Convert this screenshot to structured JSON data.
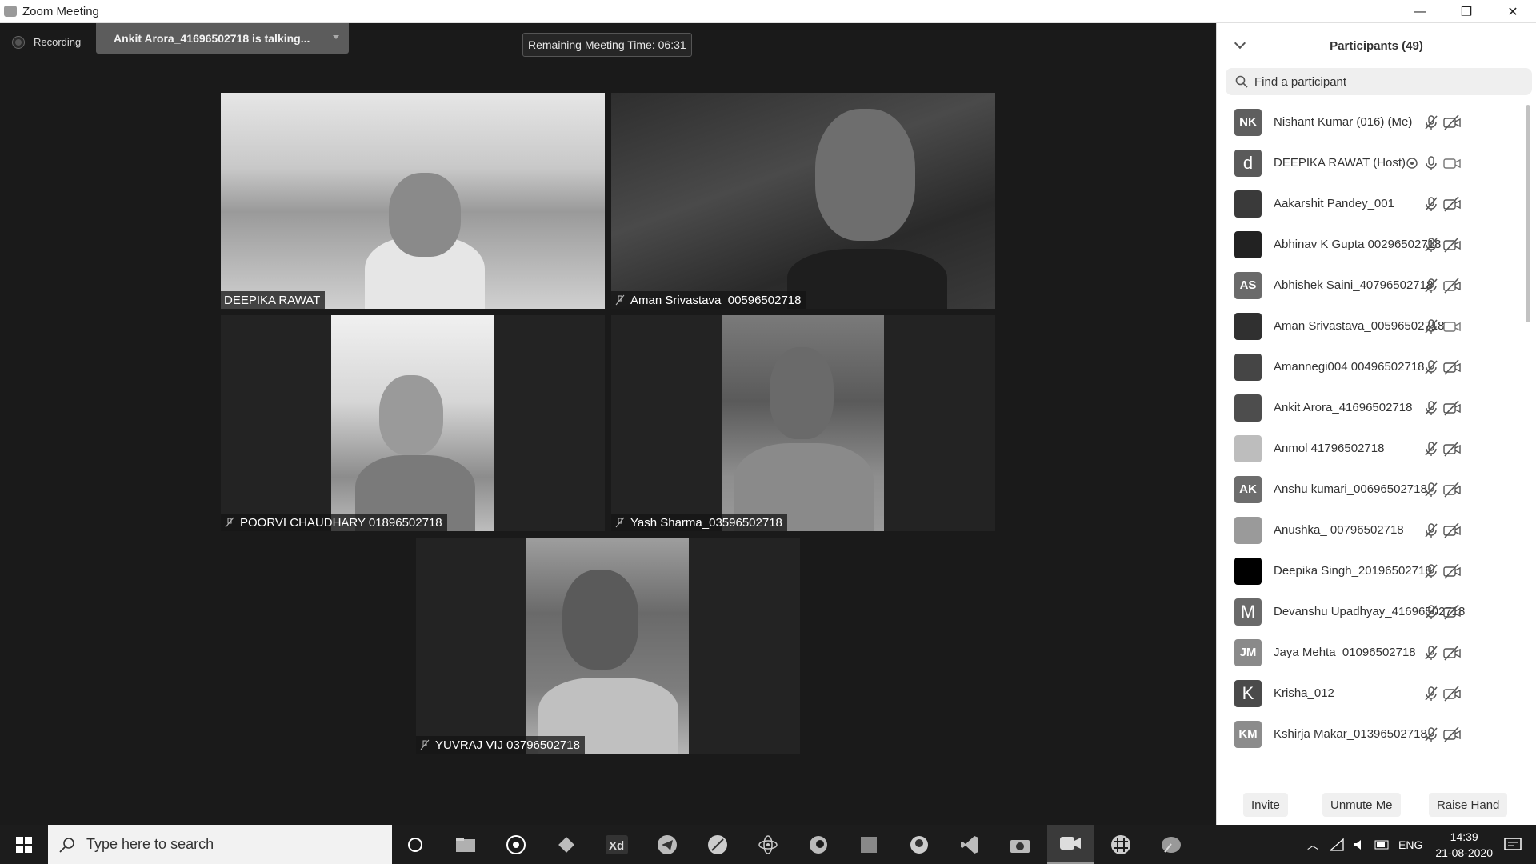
{
  "window": {
    "title": "Zoom Meeting",
    "minimize": "—",
    "restore": "❐",
    "close": "✕"
  },
  "meeting": {
    "recording_label": "Recording",
    "talking_label": "Ankit Arora_41696502718 is talking...",
    "remaining_time": "Remaining Meeting Time: 06:31"
  },
  "videos": [
    {
      "name": "DEEPIKA RAWAT"
    },
    {
      "name": "Aman Srivastava_00596502718"
    },
    {
      "name": "POORVI CHAUDHARY 01896502718"
    },
    {
      "name": "Yash Sharma_03596502718"
    },
    {
      "name": "YUVRAJ VIJ 03796502718"
    }
  ],
  "participants_panel": {
    "title": "Participants (49)",
    "search_placeholder": "Find a participant",
    "participants": [
      {
        "name": "Nishant Kumar (016) (Me)",
        "avatar": "NK",
        "avatar_color": "#5f5f5f",
        "audio": "muted",
        "video": "off"
      },
      {
        "name": "DEEPIKA RAWAT (Host)",
        "avatar": "d",
        "avatar_color": "#5a5a5a",
        "audio": "on",
        "video": "on"
      },
      {
        "name": "Aakarshit Pandey_001",
        "avatar": "",
        "avatar_color": "#3a3a3a",
        "audio": "muted",
        "video": "off"
      },
      {
        "name": "Abhinav K Gupta 00296502718",
        "avatar": "",
        "avatar_color": "#222222",
        "audio": "muted",
        "video": "off"
      },
      {
        "name": "Abhishek Saini_40796502718",
        "avatar": "AS",
        "avatar_color": "#6a6a6a",
        "audio": "muted",
        "video": "off"
      },
      {
        "name": "Aman Srivastava_00596502718",
        "avatar": "",
        "avatar_color": "#303030",
        "audio": "muted",
        "video": "on"
      },
      {
        "name": "Amannegi004 00496502718",
        "avatar": "",
        "avatar_color": "#454545",
        "audio": "muted",
        "video": "off"
      },
      {
        "name": "Ankit Arora_41696502718",
        "avatar": "",
        "avatar_color": "#4d4d4d",
        "audio": "muted",
        "video": "off"
      },
      {
        "name": "Anmol  41796502718",
        "avatar": "",
        "avatar_color": "#bdbdbd",
        "audio": "muted",
        "video": "off"
      },
      {
        "name": "Anshu kumari_00696502718",
        "avatar": "AK",
        "avatar_color": "#6d6d6d",
        "audio": "muted",
        "video": "off"
      },
      {
        "name": "Anushka_ 00796502718",
        "avatar": "",
        "avatar_color": "#9a9a9a",
        "audio": "muted",
        "video": "off"
      },
      {
        "name": "Deepika Singh_20196502718",
        "avatar": "",
        "avatar_color": "#000000",
        "audio": "muted",
        "video": "off"
      },
      {
        "name": "Devanshu Upadhyay_41696502718",
        "avatar": "M",
        "avatar_color": "#6a6a6a",
        "audio": "muted",
        "video": "off"
      },
      {
        "name": "Jaya Mehta_01096502718",
        "avatar": "JM",
        "avatar_color": "#8a8a8a",
        "audio": "muted",
        "video": "off"
      },
      {
        "name": "Krisha_012",
        "avatar": "K",
        "avatar_color": "#4a4a4a",
        "audio": "muted",
        "video": "off"
      },
      {
        "name": "Kshirja Makar_01396502718",
        "avatar": "KM",
        "avatar_color": "#8c8c8c",
        "audio": "muted",
        "video": "off"
      }
    ],
    "invite_label": "Invite",
    "unmute_label": "Unmute Me",
    "raise_hand_label": "Raise Hand"
  },
  "taskbar": {
    "search_placeholder": "Type here to search",
    "language": "ENG",
    "time": "14:39",
    "date": "21-08-2020"
  }
}
